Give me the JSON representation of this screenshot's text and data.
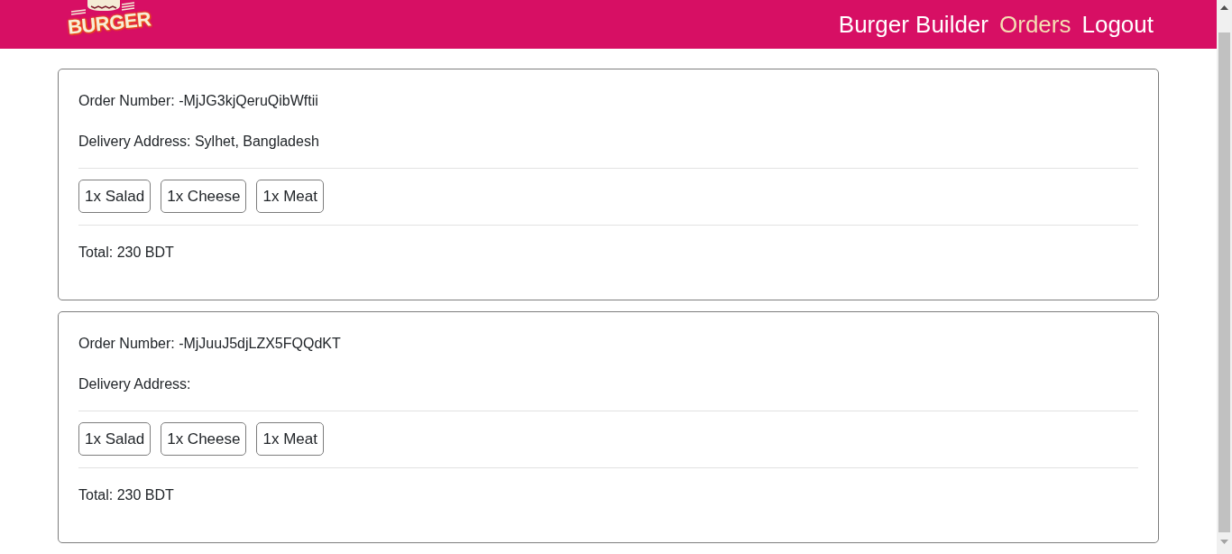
{
  "header": {
    "logo": {
      "text": "BURGER"
    },
    "nav": [
      {
        "label": "Burger Builder",
        "selected": false
      },
      {
        "label": "Orders",
        "selected": true
      },
      {
        "label": "Logout",
        "selected": false
      }
    ]
  },
  "orders": [
    {
      "order_number": "Order Number: -MjJG3kjQeruQibWftii",
      "delivery_address": "Delivery Address: Sylhet, Bangladesh",
      "ingredients": [
        "1x Salad",
        "1x Cheese",
        "1x Meat"
      ],
      "total": "Total: 230 BDT"
    },
    {
      "order_number": "Order Number: -MjJuuJ5djLZX5FQQdKT",
      "delivery_address": "Delivery Address:",
      "ingredients": [
        "1x Salad",
        "1x Cheese",
        "1x Meat"
      ],
      "total": "Total: 230 BDT"
    }
  ]
}
